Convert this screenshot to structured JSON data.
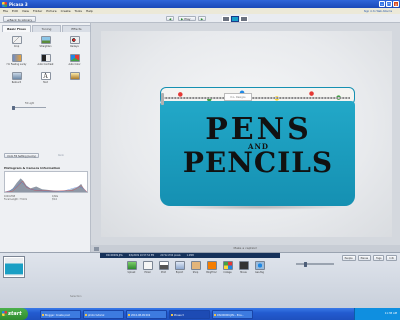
{
  "window": {
    "title": "Picasa 3"
  },
  "menu": {
    "items": [
      "File",
      "Edit",
      "View",
      "Folder",
      "Picture",
      "Create",
      "Tools",
      "Help"
    ],
    "signin": "Sign in to Web Albums"
  },
  "toolbar": {
    "back_label": "Back to Library",
    "play_label": "Play"
  },
  "left_panel": {
    "tabs": [
      "Basic Fixes",
      "Tuning",
      "Effects"
    ],
    "tools": [
      {
        "label": "Crop",
        "icon": "crop-icon"
      },
      {
        "label": "Straighten",
        "icon": "straighten-icon"
      },
      {
        "label": "Redeye",
        "icon": "redeye-icon"
      },
      {
        "label": "I'm Feeling Lucky",
        "icon": "lucky-icon"
      },
      {
        "label": "Auto Contrast",
        "icon": "contrast-icon"
      },
      {
        "label": "Auto Color",
        "icon": "color-icon"
      },
      {
        "label": "Retouch",
        "icon": "retouch-icon"
      },
      {
        "label": "Text",
        "icon": "text-icon"
      }
    ],
    "fill_light_label": "Fill Light",
    "undo_label": "Undo Fill Setting (Lucky)",
    "redo_label": "Redo",
    "histogram_title": "Histogram & Camera Information",
    "info_left": [
      "1024x768",
      "Focal Length: 7.5mm"
    ],
    "info_right": [
      "1/60s",
      "f/4.0"
    ]
  },
  "photo": {
    "tag_text": "D.L. Designs",
    "line1": "PENS",
    "line2": "AND",
    "line3": "PENCILS"
  },
  "caption": {
    "placeholder": "Make a caption!"
  },
  "bottom": {
    "info_items": [
      "DSC00009.JPG",
      "6/6/2009 10:57:54 PM",
      "2272x1704 pixels",
      "1.2MB"
    ],
    "selection_label": "Selection",
    "actions": [
      {
        "label": "Upload",
        "icon": "upload-icon"
      },
      {
        "label": "Email",
        "icon": "email-icon"
      },
      {
        "label": "Print",
        "icon": "print-icon"
      },
      {
        "label": "Export",
        "icon": "export-icon"
      },
      {
        "label": "Shop",
        "icon": "shop-icon"
      },
      {
        "label": "BlogThis!",
        "icon": "blogthis-icon"
      },
      {
        "label": "Collage",
        "icon": "collage-icon"
      },
      {
        "label": "Movie",
        "icon": "movie-icon"
      },
      {
        "label": "Geo-Tag",
        "icon": "geotag-icon"
      }
    ],
    "right_buttons": [
      "People",
      "Places",
      "Tags",
      "Info"
    ]
  },
  "taskbar": {
    "start_label": "start",
    "tasks": [
      "Blogger: Create post",
      "photo tutorial",
      "2010-08-09 002",
      "Picasa 3",
      "DSC00009.JPG - Pica..."
    ],
    "active_task": 3,
    "clock": "11:38 AM"
  }
}
